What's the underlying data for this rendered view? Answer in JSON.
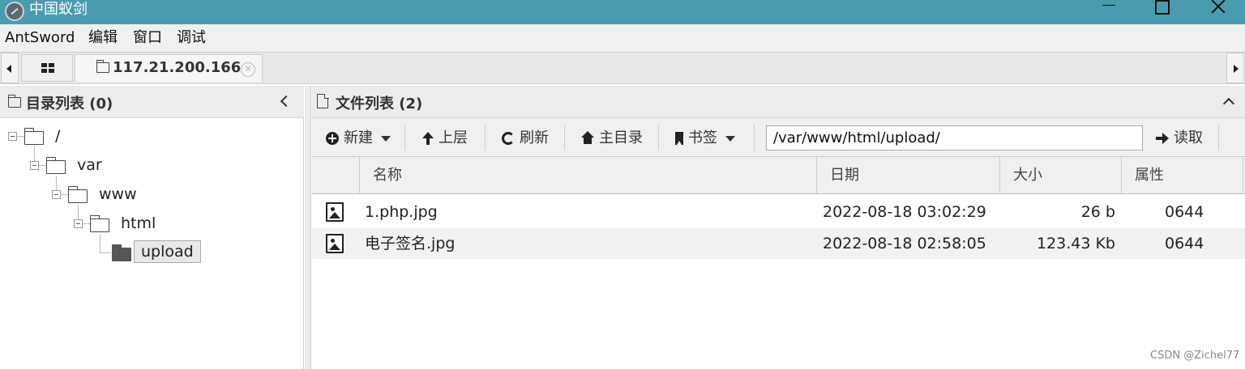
{
  "window": {
    "title": "中国蚁剑"
  },
  "menu": {
    "items": [
      "AntSword",
      "编辑",
      "窗口",
      "调试"
    ]
  },
  "tabs": {
    "host_label": "117.21.200.166"
  },
  "dir_panel": {
    "title": "目录列表 (0)",
    "tree": [
      {
        "label": "/",
        "depth": 0
      },
      {
        "label": "var",
        "depth": 1
      },
      {
        "label": "www",
        "depth": 2
      },
      {
        "label": "html",
        "depth": 3
      },
      {
        "label": "upload",
        "depth": 4,
        "selected": true
      }
    ]
  },
  "file_panel": {
    "title": "文件列表 (2)",
    "toolbar": {
      "new_label": "新建",
      "up_label": "上层",
      "refresh_label": "刷新",
      "home_label": "主目录",
      "bookmark_label": "书签",
      "path_value": "/var/www/html/upload/",
      "read_label": "读取"
    },
    "columns": [
      "名称",
      "日期",
      "大小",
      "属性"
    ],
    "files": [
      {
        "name": "1.php.jpg",
        "date": "2022-08-18 03:02:29",
        "size": "26 b",
        "perm": "0644"
      },
      {
        "name": "电子签名.jpg",
        "date": "2022-08-18 02:58:05",
        "size": "123.43 Kb",
        "perm": "0644"
      }
    ]
  },
  "watermark": "CSDN @Zichel77"
}
